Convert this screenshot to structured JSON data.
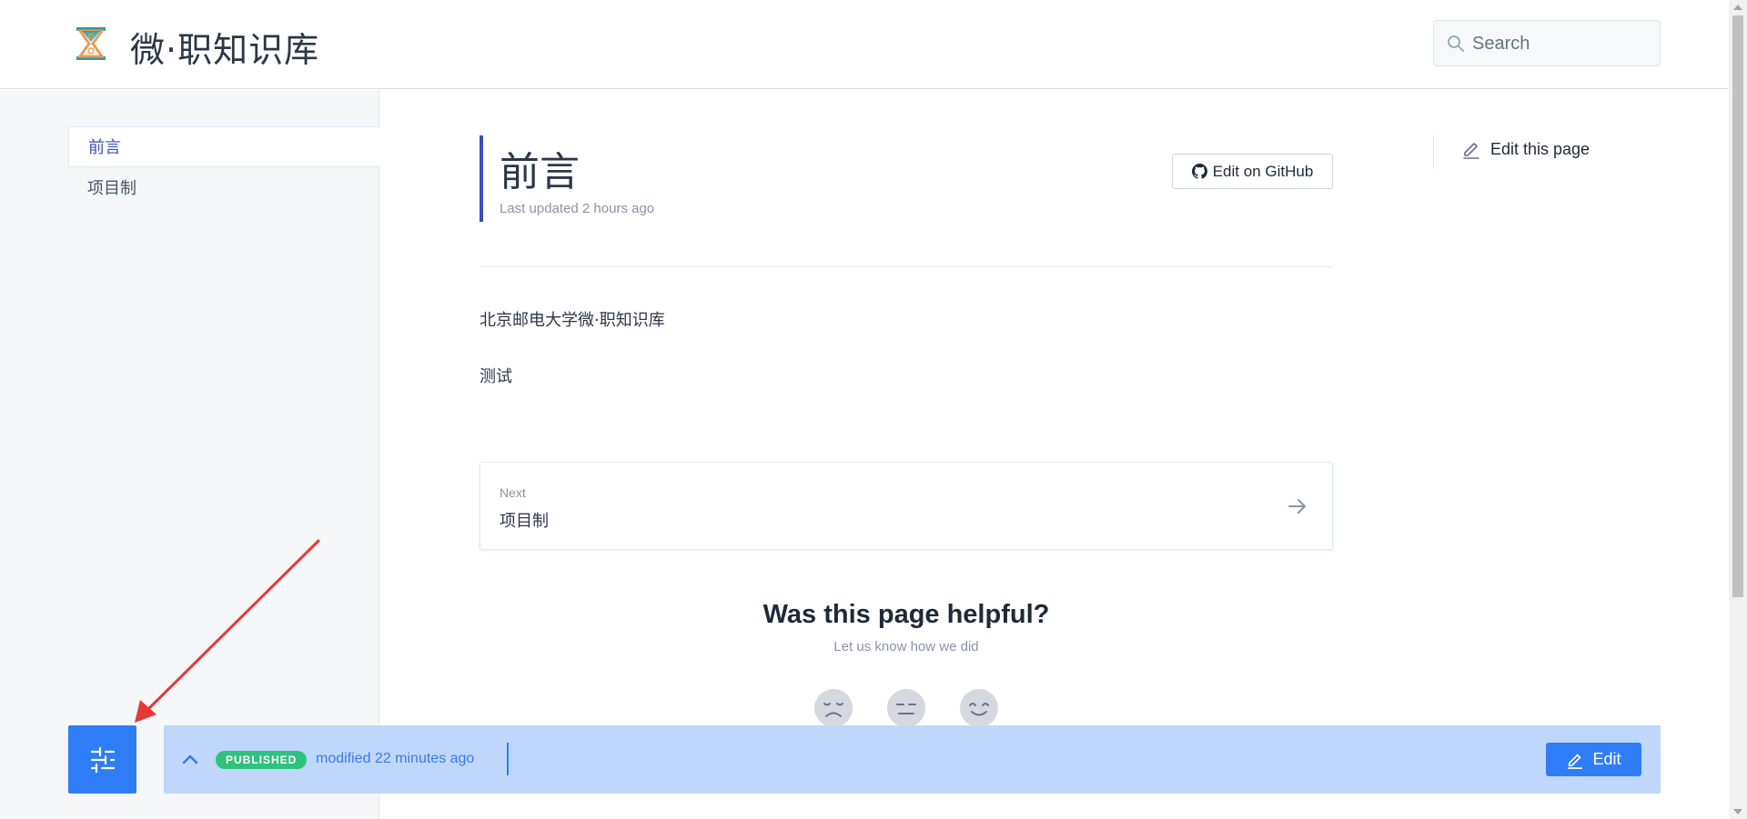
{
  "header": {
    "site_title": "微·职知识库",
    "search_placeholder": "Search"
  },
  "sidebar": {
    "items": [
      {
        "label": "前言",
        "active": true
      },
      {
        "label": "项目制",
        "active": false
      }
    ]
  },
  "article": {
    "title": "前言",
    "last_updated": "Last updated 2 hours ago",
    "github_button": "Edit on GitHub",
    "paragraphs": [
      "北京邮电大学微·职知识库",
      "测试"
    ]
  },
  "next": {
    "label": "Next",
    "title": "项目制"
  },
  "feedback": {
    "title": "Was this page helpful?",
    "subtitle": "Let us know how we did",
    "faces": [
      "sad-face-icon",
      "neutral-face-icon",
      "happy-face-icon"
    ]
  },
  "right_column": {
    "edit_link": "Edit this page"
  },
  "status_bar": {
    "badge": "PUBLISHED",
    "modified": "modified 22 minutes ago",
    "edit_button": "Edit"
  },
  "colors": {
    "accent": "#3b4eb8",
    "primary_button": "#2f7df6",
    "status_bar_bg": "#bfd7fb",
    "published_badge": "#2ec27e",
    "annotation_arrow": "#e53935"
  }
}
